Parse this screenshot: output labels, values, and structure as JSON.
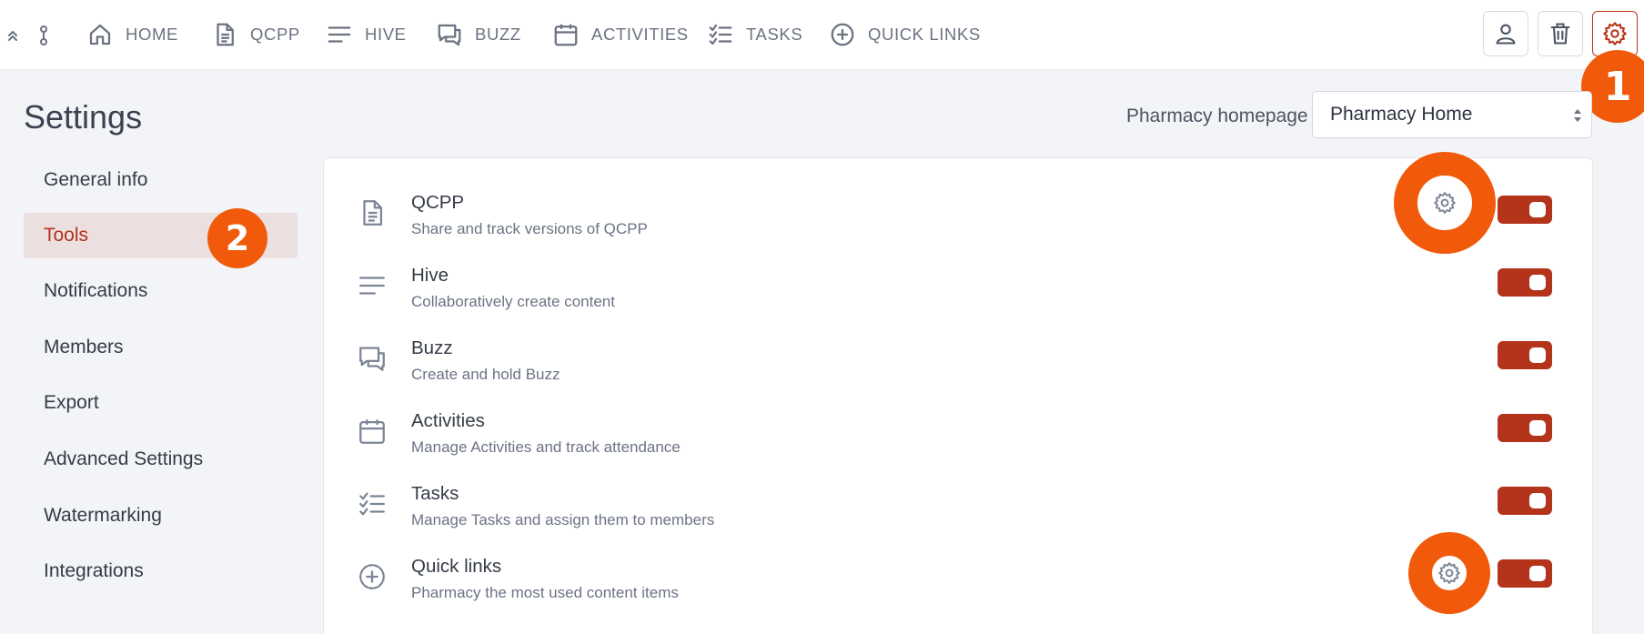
{
  "nav": {
    "items": [
      {
        "label": "HOME",
        "icon": "home-icon"
      },
      {
        "label": "QCPP",
        "icon": "document-icon"
      },
      {
        "label": "HIVE",
        "icon": "lines-icon"
      },
      {
        "label": "BUZZ",
        "icon": "chat-icon"
      },
      {
        "label": "ACTIVITIES",
        "icon": "calendar-icon"
      },
      {
        "label": "TASKS",
        "icon": "checklist-icon"
      },
      {
        "label": "QUICK LINKS",
        "icon": "plus-circle-icon"
      }
    ],
    "buttons": [
      "user-icon",
      "trash-icon",
      "gear-icon"
    ]
  },
  "page": {
    "title": "Settings",
    "homepage_label": "Pharmacy homepage",
    "homepage_value": "Pharmacy Home"
  },
  "sidebar": {
    "items": [
      {
        "label": "General info"
      },
      {
        "label": "Tools"
      },
      {
        "label": "Notifications"
      },
      {
        "label": "Members"
      },
      {
        "label": "Export"
      },
      {
        "label": "Advanced Settings"
      },
      {
        "label": "Watermarking"
      },
      {
        "label": "Integrations"
      }
    ],
    "active": "Tools"
  },
  "tools": [
    {
      "title": "QCPP",
      "description": "Share and track versions of QCPP",
      "icon": "document-icon",
      "enabled": true,
      "has_settings": true
    },
    {
      "title": "Hive",
      "description": "Collaboratively create content",
      "icon": "lines-icon",
      "enabled": true,
      "has_settings": false
    },
    {
      "title": "Buzz",
      "description": "Create and hold Buzz",
      "icon": "chat-icon",
      "enabled": true,
      "has_settings": false
    },
    {
      "title": "Activities",
      "description": "Manage Activities and track attendance",
      "icon": "calendar-icon",
      "enabled": true,
      "has_settings": false
    },
    {
      "title": "Tasks",
      "description": "Manage Tasks and assign them to members",
      "icon": "checklist-icon",
      "enabled": true,
      "has_settings": false
    },
    {
      "title": "Quick links",
      "description": "Pharmacy the most used content items",
      "icon": "plus-circle-icon",
      "enabled": true,
      "has_settings": true
    }
  ],
  "callouts": [
    "1",
    "2"
  ],
  "colors": {
    "accent": "#b3341b",
    "callout": "#f05a0a",
    "active_bg": "#ecdfe0",
    "icon_gray": "#7c8596"
  }
}
